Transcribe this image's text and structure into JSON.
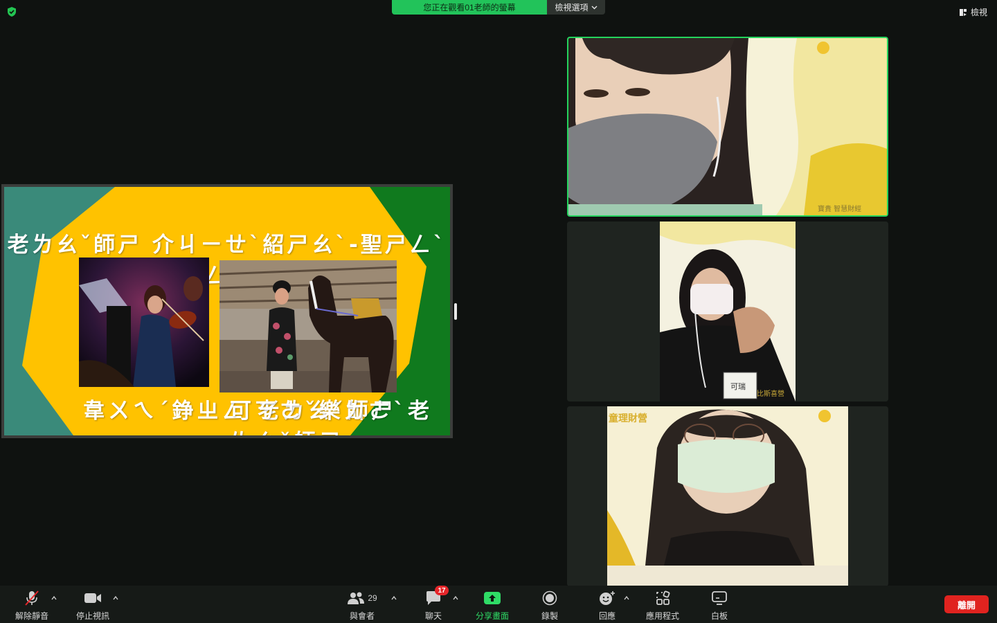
{
  "topbar": {
    "banner_text": "您正在觀看01老師的螢幕",
    "view_options_label": "檢視選項",
    "view_label": "檢視"
  },
  "slide": {
    "title": "老ㄌㄠˇ師ㄕ 介ㄐㄧㄝˋ紹ㄕㄠˋ-聖ㄕㄥˋ經ㄐㄧㄥ 課ㄎㄜˋ",
    "caption_left": "韋ㄨㄟˊ錚ㄓㄥ 老ㄌㄠˇ師ㄕ",
    "caption_right": "可ㄎㄜˇ樂ㄌㄜˋ老ㄌㄠˇ師ㄕ",
    "colors": {
      "teal": "#3a8a7a",
      "yellow": "#ffc200",
      "green": "#107a1e"
    }
  },
  "videos": [
    {
      "active": true,
      "overlay_text": "寶貴 智慧財經"
    },
    {
      "active": false,
      "overlay_text": "比斯喜營",
      "badge_text": "可瑞"
    },
    {
      "active": false,
      "overlay_text": "童理財營"
    }
  ],
  "toolbar": {
    "unmute_label": "解除靜音",
    "stop_video_label": "停止視訊",
    "participants_label": "與會者",
    "participants_count": "29",
    "chat_label": "聊天",
    "chat_badge": "17",
    "share_label": "分享畫面",
    "record_label": "錄製",
    "reactions_label": "回應",
    "apps_label": "應用程式",
    "whiteboard_label": "白板",
    "leave_label": "離開",
    "share_color": "#2fdc66",
    "leave_color": "#e0231f"
  }
}
